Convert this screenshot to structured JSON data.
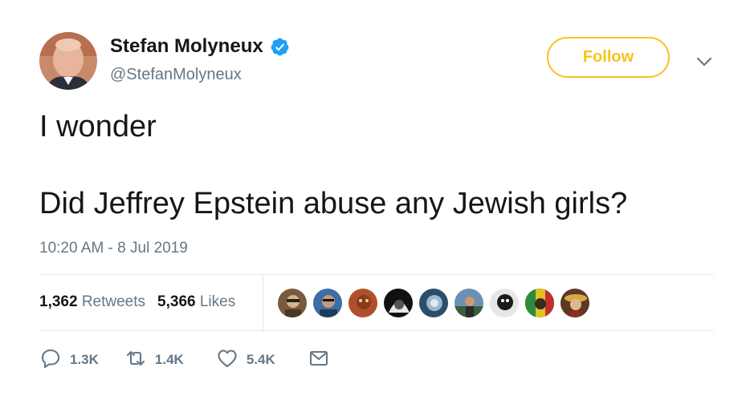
{
  "tweet": {
    "author": {
      "display_name": "Stefan Molyneux",
      "handle": "@StefanMolyneux",
      "verified": true
    },
    "follow_label": "Follow",
    "text_lines": [
      "I wonder",
      "Did Jeffrey Epstein abuse any Jewish girls?"
    ],
    "timestamp": "10:20 AM - 8 Jul 2019",
    "stats": {
      "retweets_count": "1,362",
      "retweets_label": "Retweets",
      "likes_count": "5,366",
      "likes_label": "Likes"
    },
    "actions": {
      "reply_count": "1.3K",
      "retweet_count": "1.4K",
      "like_count": "5.4K"
    }
  },
  "icons": {
    "verified": "verified-badge-icon",
    "caret": "chevron-down-icon",
    "reply": "reply-icon",
    "retweet": "retweet-icon",
    "like": "heart-icon",
    "message": "envelope-icon"
  },
  "colors": {
    "follow_accent": "#f5c41d",
    "verified_blue": "#1da1f2",
    "secondary_text": "#657786",
    "primary_text": "#14171a",
    "divider": "#e1e8ed"
  }
}
